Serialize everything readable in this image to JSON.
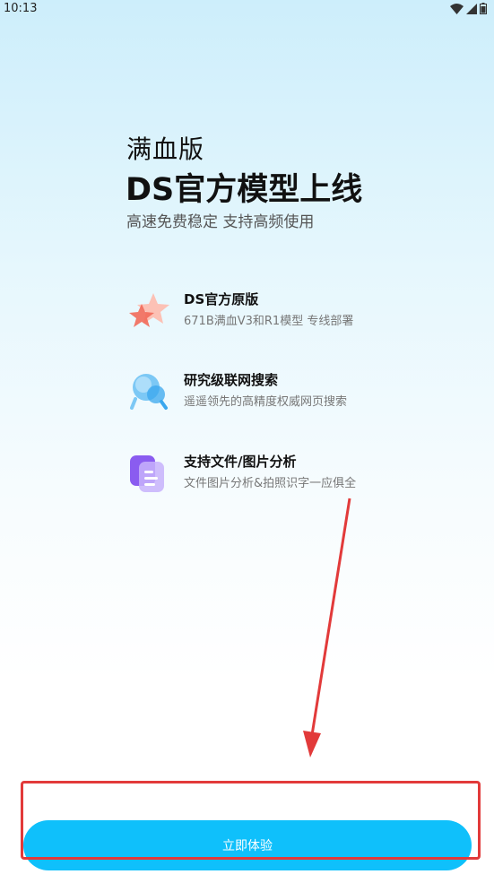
{
  "status_bar": {
    "time": "10:13",
    "icons": [
      "wifi-icon",
      "signal-icon",
      "battery-icon"
    ]
  },
  "hero": {
    "subtitle": "满血版",
    "title": "DS官方模型上线",
    "description": "高速免费稳定 支持高频使用"
  },
  "features": [
    {
      "icon": "star-icon",
      "title": "DS官方原版",
      "description": "671B满血V3和R1模型 专线部署"
    },
    {
      "icon": "search-bubble-icon",
      "title": "研究级联网搜索",
      "description": "遥遥领先的高精度权威网页搜索"
    },
    {
      "icon": "document-icon",
      "title": "支持文件/图片分析",
      "description": "文件图片分析&拍照识字一应俱全"
    }
  ],
  "cta": {
    "label": "立即体验"
  },
  "colors": {
    "cta_background": "#0fc0fb",
    "annotation_red": "#e23a3a",
    "star_accent": "#f26a5a",
    "search_accent": "#3aa7ee",
    "document_accent": "#8a5cf0"
  }
}
